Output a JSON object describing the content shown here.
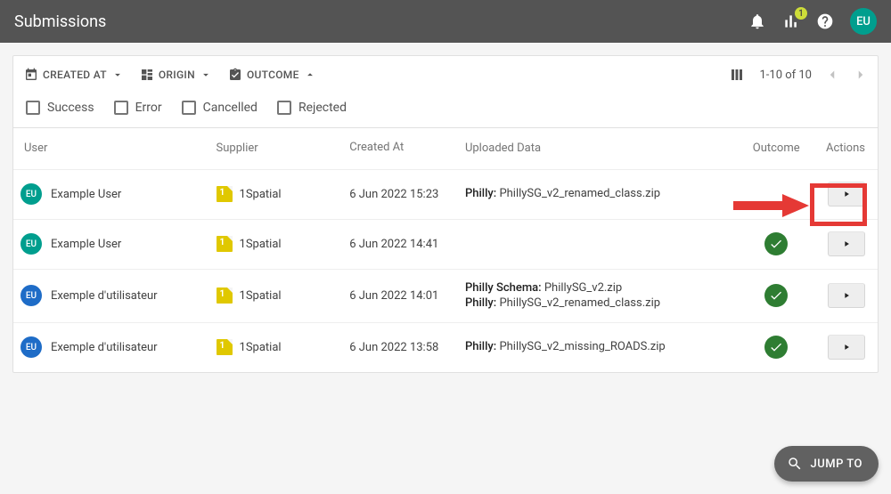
{
  "appbar": {
    "title": "Submissions",
    "avatar": "EU",
    "chart_badge": "1"
  },
  "filters": {
    "created_at": "CREATED AT",
    "origin": "ORIGIN",
    "outcome": "OUTCOME",
    "columns_icon": "columns",
    "pager_label": "1-10 of 10"
  },
  "outcome_filters": [
    "Success",
    "Error",
    "Cancelled",
    "Rejected"
  ],
  "columns": {
    "user": "User",
    "supplier": "Supplier",
    "created": "Created At",
    "data": "Uploaded Data",
    "outcome": "Outcome",
    "actions": "Actions"
  },
  "rows": [
    {
      "avatar": "EU",
      "avatar_color": "green",
      "user": "Example User",
      "supplier": "1Spatial",
      "created": "6 Jun 2022 15:23",
      "uploads": [
        {
          "label": "Philly:",
          "file": "PhillySG_v2_renamed_class.zip"
        }
      ],
      "outcome": "none",
      "highlight_action": true,
      "callout_arrow": true
    },
    {
      "avatar": "EU",
      "avatar_color": "green",
      "user": "Example User",
      "supplier": "1Spatial",
      "created": "6 Jun 2022 14:41",
      "uploads": [],
      "outcome": "success"
    },
    {
      "avatar": "EU",
      "avatar_color": "blue",
      "user": "Exemple d'utilisateur",
      "supplier": "1Spatial",
      "created": "6 Jun 2022 14:01",
      "uploads": [
        {
          "label": "Philly Schema:",
          "file": "PhillySG_v2.zip"
        },
        {
          "label": "Philly:",
          "file": "PhillySG_v2_renamed_class.zip"
        }
      ],
      "outcome": "success"
    },
    {
      "avatar": "EU",
      "avatar_color": "blue",
      "user": "Exemple d'utilisateur",
      "supplier": "1Spatial",
      "created": "6 Jun 2022 13:58",
      "uploads": [
        {
          "label": "Philly:",
          "file": "PhillySG_v2_missing_ROADS.zip"
        }
      ],
      "outcome": "success"
    }
  ],
  "jump": {
    "label": "JUMP TO"
  }
}
